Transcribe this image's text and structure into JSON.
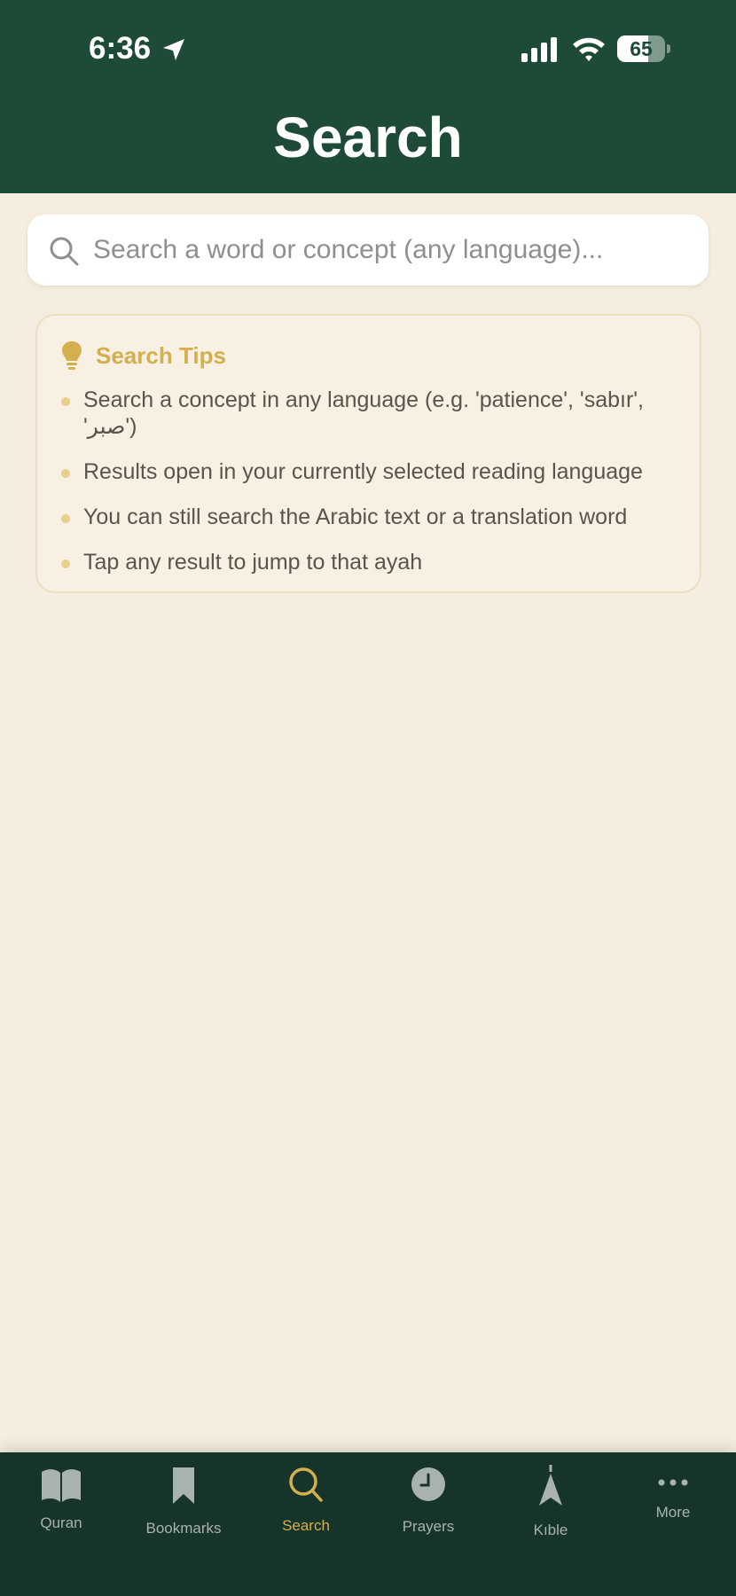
{
  "status_bar": {
    "time": "6:36",
    "battery": "65",
    "battery_level": 0.65
  },
  "header": {
    "title": "Search"
  },
  "search": {
    "placeholder": "Search a word or concept (any language)..."
  },
  "tips": {
    "title": "Search Tips",
    "items": [
      "Search a concept in any language (e.g. 'patience', 'sabır', 'صبر')",
      "Results open in your currently selected reading language",
      "You can still search the Arabic text or a translation word",
      "Tap any result to jump to that ayah"
    ]
  },
  "tab_bar": {
    "items": [
      {
        "label": "Quran",
        "icon": "book-icon"
      },
      {
        "label": "Bookmarks",
        "icon": "bookmark-icon"
      },
      {
        "label": "Search",
        "icon": "search-icon"
      },
      {
        "label": "Prayers",
        "icon": "clock-icon"
      },
      {
        "label": "Kıble",
        "icon": "compass-arrow-icon"
      },
      {
        "label": "More",
        "icon": "ellipsis-icon"
      }
    ],
    "active": "Search"
  },
  "colors": {
    "header_bg": "#1e4a38",
    "page_bg": "#f5eee0",
    "accent_gold": "#d4af4f",
    "tab_bar_bg": "#16342a"
  }
}
